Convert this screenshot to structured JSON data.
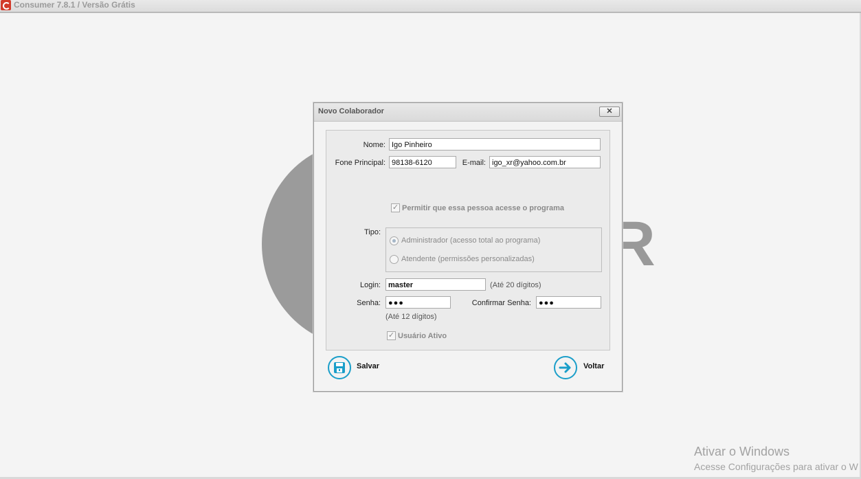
{
  "app": {
    "title": "Consumer 7.8.1 / Versão Grátis",
    "background_text": "ER"
  },
  "dialog": {
    "title": "Novo Colaborador",
    "close_glyph": "✕",
    "fields": {
      "nome": {
        "label": "Nome:",
        "value": "Igo Pinheiro"
      },
      "fone": {
        "label": "Fone Principal:",
        "value": "98138-6120"
      },
      "email": {
        "label": "E-mail:",
        "value": "igo_xr@yahoo.com.br"
      }
    },
    "permitir_acesso": {
      "label": "Permitir que essa pessoa acesse o programa",
      "checked": true
    },
    "tipo": {
      "label": "Tipo:",
      "options": [
        {
          "label": "Administrador (acesso total ao programa)",
          "selected": true
        },
        {
          "label": "Atendente (permissões personalizadas)",
          "selected": false
        }
      ]
    },
    "login": {
      "label": "Login:",
      "value": "master",
      "hint": "(Até 20 dígitos)"
    },
    "senha": {
      "label": "Senha:",
      "value": "●●●",
      "hint": "(Até 12 dígitos)"
    },
    "confirmar_senha": {
      "label": "Confirmar Senha:",
      "value": "●●●"
    },
    "usuario_ativo": {
      "label": "Usuário Ativo",
      "checked": true
    },
    "buttons": {
      "salvar": {
        "label": "Salvar",
        "icon": "floppy-disk-icon"
      },
      "voltar": {
        "label": "Voltar",
        "icon": "arrow-right-icon"
      }
    }
  },
  "watermark": {
    "line1": "Ativar o Windows",
    "line2": "Acesse Configurações para ativar o W"
  },
  "colors": {
    "accent": "#1a9ec9",
    "background": "#f4f4f4"
  }
}
